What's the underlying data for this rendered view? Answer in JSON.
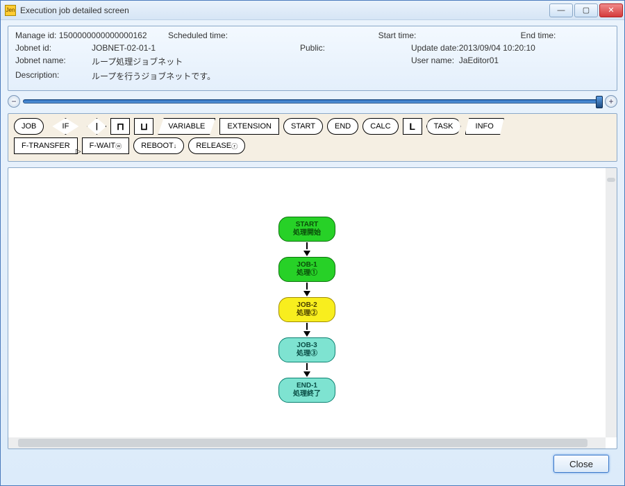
{
  "window": {
    "title": "Execution job detailed screen",
    "icon_text": "Jen"
  },
  "info": {
    "manage_id_label": "Manage id:",
    "manage_id": "1500000000000000162",
    "scheduled_time_label": "Scheduled time:",
    "scheduled_time": "",
    "start_time_label": "Start time:",
    "start_time": "",
    "end_time_label": "End time:",
    "end_time": "",
    "jobnet_id_label": "Jobnet id:",
    "jobnet_id": "JOBNET-02-01-1",
    "public_label": "Public:",
    "public": "",
    "update_date_label": "Update date:",
    "update_date": "2013/09/04 10:20:10",
    "jobnet_name_label": "Jobnet name:",
    "jobnet_name": "ループ処理ジョブネット",
    "user_name_label": "User name:",
    "user_name": "JaEditor01",
    "description_label": "Description:",
    "description": "ループを行うジョブネットです。"
  },
  "palette": {
    "row1": [
      "JOB",
      "IF",
      "|",
      "⊓",
      "⊔",
      "VARIABLE",
      "EXTENSION",
      "START",
      "END",
      "CALC",
      "L",
      "TASK",
      "INFO"
    ],
    "row2": [
      "F-TRANSFER",
      "F-WAIT",
      "REBOOT",
      "RELEASE"
    ],
    "row2_suffix": [
      "",
      "ⓦ",
      "↓",
      "ⓡ"
    ]
  },
  "flow": [
    {
      "id": "START",
      "sub": "処理開始",
      "style": "node-start"
    },
    {
      "id": "JOB-1",
      "sub": "処理①",
      "style": "node-green"
    },
    {
      "id": "JOB-2",
      "sub": "処理②",
      "style": "node-yellow"
    },
    {
      "id": "JOB-3",
      "sub": "処理③",
      "style": "node-teal"
    },
    {
      "id": "END-1",
      "sub": "処理終了",
      "style": "node-teal"
    }
  ],
  "footer": {
    "close": "Close"
  }
}
